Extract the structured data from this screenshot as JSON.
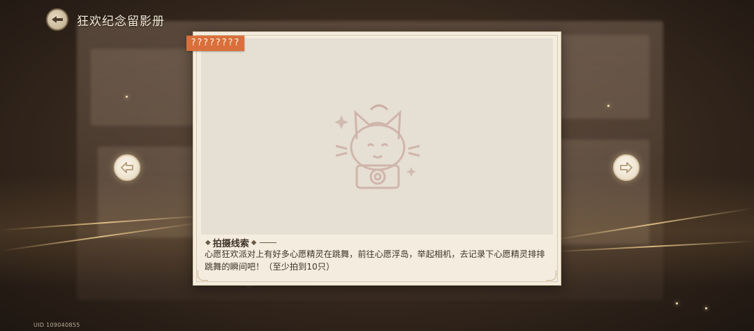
{
  "header": {
    "title": "狂欢纪念留影册",
    "back_icon": "back-arrow-icon"
  },
  "card": {
    "tag": "????????",
    "placeholder_icon": "cat-camera-placeholder-icon",
    "clue_title": "拍摄线索",
    "clue_text": "心愿狂欢派对上有好多心愿精灵在跳舞，前往心愿浮岛，举起相机，去记录下心愿精灵排排跳舞的瞬间吧！（至少拍到10只）"
  },
  "navigation": {
    "prev_icon": "arrow-left-icon",
    "next_icon": "arrow-right-icon"
  },
  "footer": {
    "uid": "UID 109040855"
  },
  "colors": {
    "tag_bg": "#d96f3b",
    "card_bg": "#f4ecdf",
    "photo_bg": "#e6dfd3",
    "text": "#3f3428"
  }
}
